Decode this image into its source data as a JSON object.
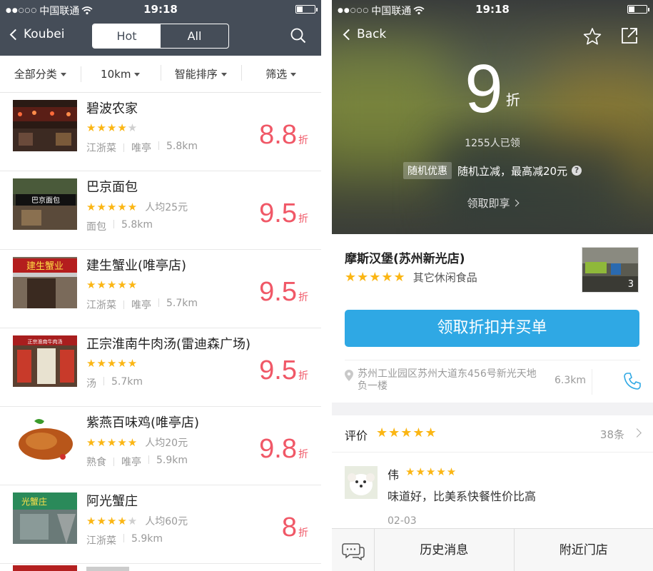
{
  "status_left": {
    "carrier": "中国联通",
    "time": "19:18"
  },
  "status_right": {
    "carrier": "中国联通",
    "time": "19:18"
  },
  "left": {
    "nav": {
      "back_label": "Koubei",
      "tabs": [
        "Hot",
        "All"
      ],
      "active_tab": "Hot"
    },
    "filters": [
      "全部分类",
      "10km",
      "智能排序",
      "筛选"
    ],
    "shops": [
      {
        "name": "碧波农家",
        "rating": 4,
        "avg": "",
        "meta": [
          "江浙菜",
          "唯亭",
          "5.8km"
        ],
        "discount": "8.8",
        "unit": "折"
      },
      {
        "name": "巴京面包",
        "rating": 5,
        "avg": "人均25元",
        "meta": [
          "面包",
          "5.8km"
        ],
        "discount": "9.5",
        "unit": "折"
      },
      {
        "name": "建生蟹业(唯亭店)",
        "rating": 5,
        "avg": "",
        "meta": [
          "江浙菜",
          "唯亭",
          "5.7km"
        ],
        "discount": "9.5",
        "unit": "折"
      },
      {
        "name": "正宗淮南牛肉汤(雷迪森广场)",
        "rating": 5,
        "avg": "",
        "meta": [
          "汤",
          "5.7km"
        ],
        "discount": "9.5",
        "unit": "折"
      },
      {
        "name": "紫燕百味鸡(唯亭店)",
        "rating": 5,
        "avg": "人均20元",
        "meta": [
          "熟食",
          "唯亭",
          "5.9km"
        ],
        "discount": "9.8",
        "unit": "折"
      },
      {
        "name": "阿光蟹庄",
        "rating": 4,
        "avg": "人均60元",
        "meta": [
          "江浙菜",
          "5.9km"
        ],
        "discount": "8",
        "unit": "折"
      }
    ],
    "thumb_text": {
      "shop2": "巴京面包",
      "shop3": "建生蟹业",
      "shop4": "正宗淮南牛肉汤",
      "shop6": "光蟹庄"
    }
  },
  "right": {
    "nav": {
      "back_label": "Back"
    },
    "hero": {
      "discount": "9",
      "unit": "折",
      "claimed": "1255人已领",
      "promo_tag": "随机优惠",
      "promo_text": "随机立减，最高减20元",
      "help_icon": "?",
      "get_now": "领取即享"
    },
    "shop": {
      "name": "摩斯汉堡(苏州新光店)",
      "rating": 5,
      "category": "其它休闲食品",
      "photo_count": "3",
      "cta": "领取折扣并买单",
      "address": "苏州工业园区苏州大道东456号新光天地负一楼",
      "distance": "6.3km"
    },
    "reviews": {
      "label": "评价",
      "rating": 5,
      "count": "38条",
      "items": [
        {
          "user": "伟",
          "rating": 5,
          "text": "味道好，比美系快餐性价比高",
          "date": "02-03"
        }
      ]
    },
    "bottom": {
      "history": "历史消息",
      "nearby": "附近门店"
    }
  },
  "colors": {
    "nav": "#454d58",
    "discount": "#f05867",
    "star": "#fbb614",
    "cta": "#2fa8e4"
  }
}
